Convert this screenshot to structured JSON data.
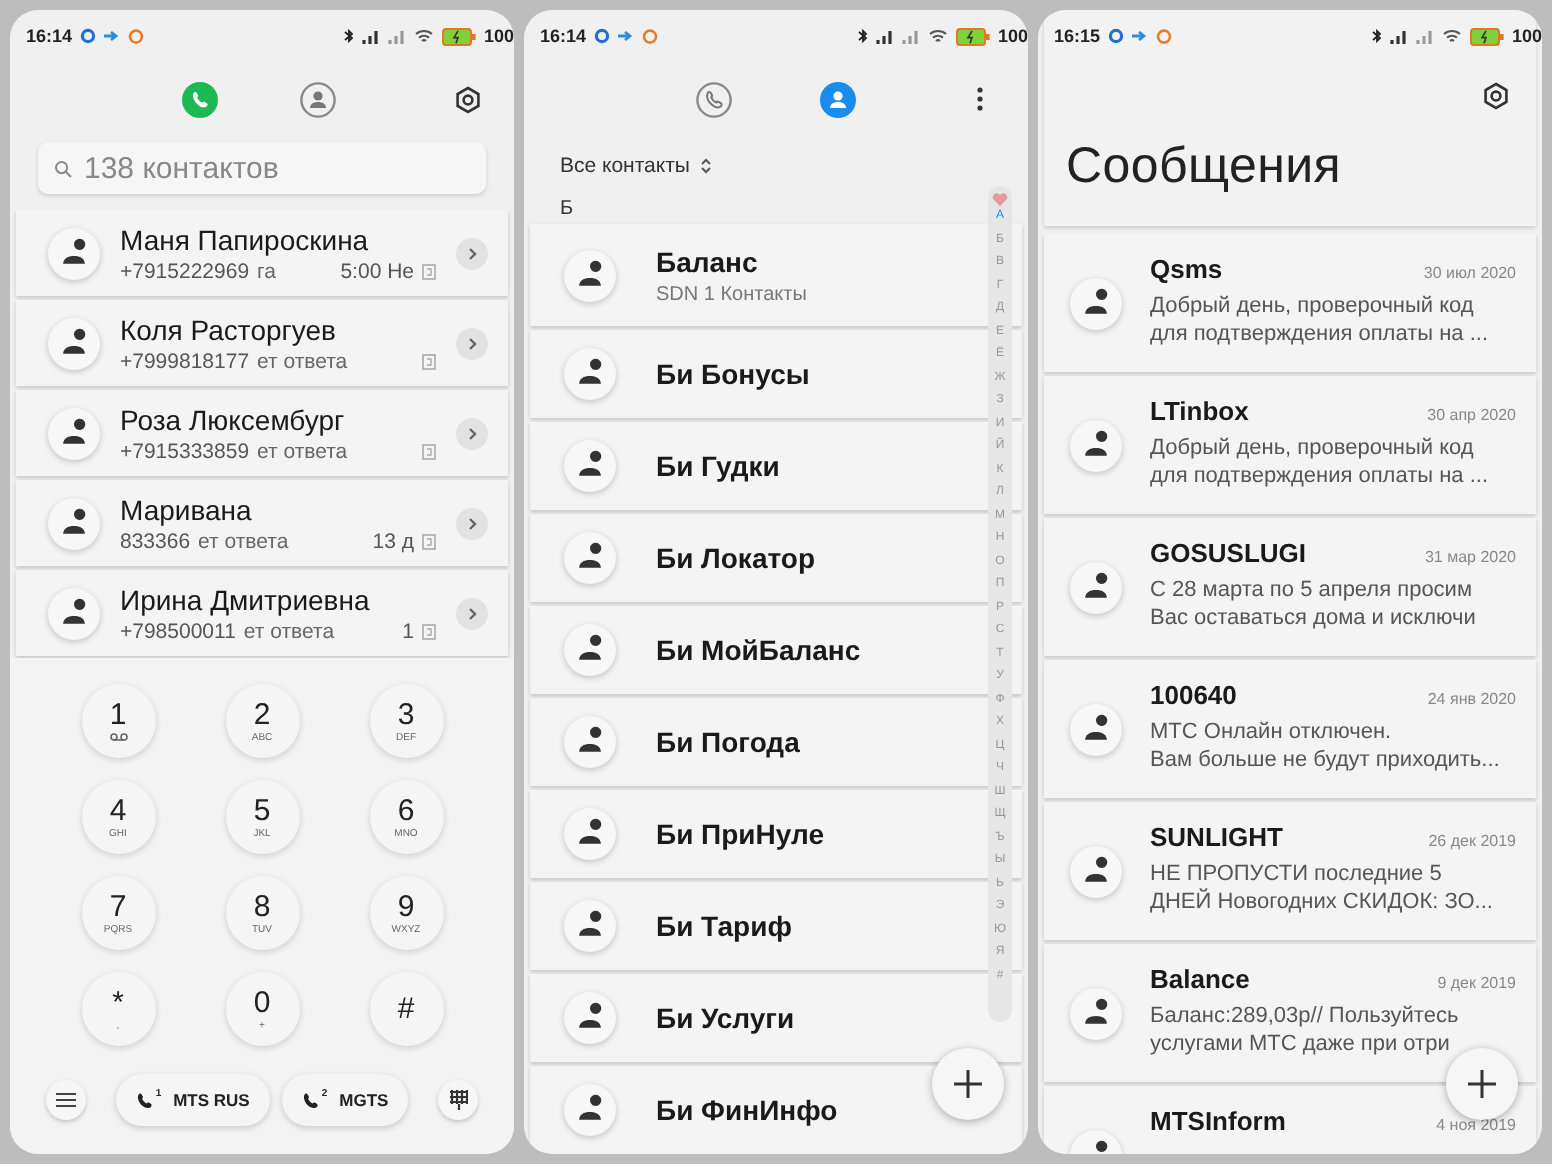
{
  "dialer": {
    "status_bar": {
      "time": "16:14",
      "battery": "100"
    },
    "tabs": [
      {
        "kind": "calls",
        "selected": true
      },
      {
        "kind": "contacts",
        "selected": false
      }
    ],
    "search": {
      "placeholder": "138 контактов"
    },
    "calls": [
      {
        "name": "Маня Папироскина",
        "number": "+7915222969",
        "status": "га",
        "time": "5:00 Не"
      },
      {
        "name": "Коля Расторгуев",
        "number": "+7999818177",
        "status": "ет ответа"
      },
      {
        "name": "Роза Люксембург",
        "number": "+7915333859",
        "status": "ет ответа"
      },
      {
        "name": "Маривана",
        "number": "833366",
        "status": "ет ответа",
        "time": "13 д"
      },
      {
        "name": "Ирина Дмитриевна",
        "number": "+798500011",
        "status": "ет ответа",
        "time": "1"
      }
    ],
    "keys": [
      {
        "kind": "voicemail",
        "digit": "1"
      },
      {
        "kind": "digit",
        "digit": "2",
        "letters": "ABC"
      },
      {
        "kind": "digit",
        "digit": "3",
        "letters": "DEF"
      },
      {
        "kind": "digit",
        "digit": "4",
        "letters": "GHI"
      },
      {
        "kind": "digit",
        "digit": "5",
        "letters": "JKL"
      },
      {
        "kind": "digit",
        "digit": "6",
        "letters": "MNO"
      },
      {
        "kind": "digit",
        "digit": "7",
        "letters": "PQRS"
      },
      {
        "kind": "digit",
        "digit": "8",
        "letters": "TUV"
      },
      {
        "kind": "digit",
        "digit": "9",
        "letters": "WXYZ"
      },
      {
        "kind": "digit",
        "digit": "*",
        "letters": ","
      },
      {
        "kind": "digit",
        "digit": "0",
        "letters": "+"
      },
      {
        "kind": "digit",
        "digit": "#"
      }
    ],
    "sim_buttons": [
      {
        "sim": "1",
        "label": "MTS RUS"
      },
      {
        "sim": "2",
        "label": "MGTS"
      }
    ]
  },
  "contacts": {
    "status_bar": {
      "time": "16:14",
      "battery": "100"
    },
    "tabs": [
      {
        "kind": "calls",
        "selected": false
      },
      {
        "kind": "contacts",
        "selected": true
      }
    ],
    "filter": "Все контакты",
    "section": "Б",
    "items": [
      {
        "name": "Баланс",
        "subtitle": "SDN 1 Контакты"
      },
      {
        "name": "Би Бонусы"
      },
      {
        "name": "Би Гудки"
      },
      {
        "name": "Би Локатор"
      },
      {
        "name": "Би МойБаланс"
      },
      {
        "name": "Би Погода"
      },
      {
        "name": "Би ПриНуле"
      },
      {
        "name": "Би Тариф"
      },
      {
        "name": "Би Услуги"
      },
      {
        "name": "Би ФинИнфо"
      }
    ],
    "index": [
      {
        "label": "А",
        "selected": true
      },
      {
        "label": "Б",
        "selected": false
      },
      {
        "label": "В",
        "selected": false
      },
      {
        "label": "Г",
        "selected": false
      },
      {
        "label": "Д",
        "selected": false
      },
      {
        "label": "Е",
        "selected": false
      },
      {
        "label": "Ё",
        "selected": false
      },
      {
        "label": "Ж",
        "selected": false
      },
      {
        "label": "З",
        "selected": false
      },
      {
        "label": "И",
        "selected": false
      },
      {
        "label": "Й",
        "selected": false
      },
      {
        "label": "К",
        "selected": false
      },
      {
        "label": "Л",
        "selected": false
      },
      {
        "label": "М",
        "selected": false
      },
      {
        "label": "Н",
        "selected": false
      },
      {
        "label": "О",
        "selected": false
      },
      {
        "label": "П",
        "selected": false
      },
      {
        "label": "Р",
        "selected": false
      },
      {
        "label": "С",
        "selected": false
      },
      {
        "label": "Т",
        "selected": false
      },
      {
        "label": "У",
        "selected": false
      },
      {
        "label": "Ф",
        "selected": false
      },
      {
        "label": "Х",
        "selected": false
      },
      {
        "label": "Ц",
        "selected": false
      },
      {
        "label": "Ч",
        "selected": false
      },
      {
        "label": "Ш",
        "selected": false
      },
      {
        "label": "Щ",
        "selected": false
      },
      {
        "label": "Ъ",
        "selected": false
      },
      {
        "label": "Ы",
        "selected": false
      },
      {
        "label": "Ь",
        "selected": false
      },
      {
        "label": "Э",
        "selected": false
      },
      {
        "label": "Ю",
        "selected": false
      },
      {
        "label": "Я",
        "selected": false
      },
      {
        "label": "#",
        "selected": false
      }
    ]
  },
  "messages": {
    "status_bar": {
      "time": "16:15",
      "battery": "100"
    },
    "title": "Сообщения",
    "threads": [
      {
        "sender": "Qsms",
        "date": "30 июл 2020",
        "lines": [
          "Добрый день, проверочный код",
          "для подтверждения оплаты на ..."
        ]
      },
      {
        "sender": "LTinbox",
        "date": "30 апр 2020",
        "lines": [
          "Добрый день, проверочный код",
          "для подтверждения оплаты на ..."
        ]
      },
      {
        "sender": "GOSUSLUGI",
        "date": "31 мар 2020",
        "lines": [
          "С 28 марта по 5 апреля просим",
          "Вас оставаться дома и исключи"
        ]
      },
      {
        "sender": "100640",
        "date": "24 янв 2020",
        "lines": [
          "МТС Онлайн отключен.",
          "Вам больше не будут приходить..."
        ]
      },
      {
        "sender": "SUNLIGHT",
        "date": "26 дек 2019",
        "lines": [
          "НЕ ПРОПУСТИ последние 5",
          "ДНЕЙ Новогодних СКИДОК: ЗО..."
        ]
      },
      {
        "sender": "Balance",
        "date": "9 дек 2019",
        "lines": [
          "Баланс:289,03р// Пользуйтесь",
          "услугами МТС даже при отри"
        ]
      },
      {
        "sender": "MTSInform",
        "date": "4 ноя 2019"
      }
    ]
  }
}
